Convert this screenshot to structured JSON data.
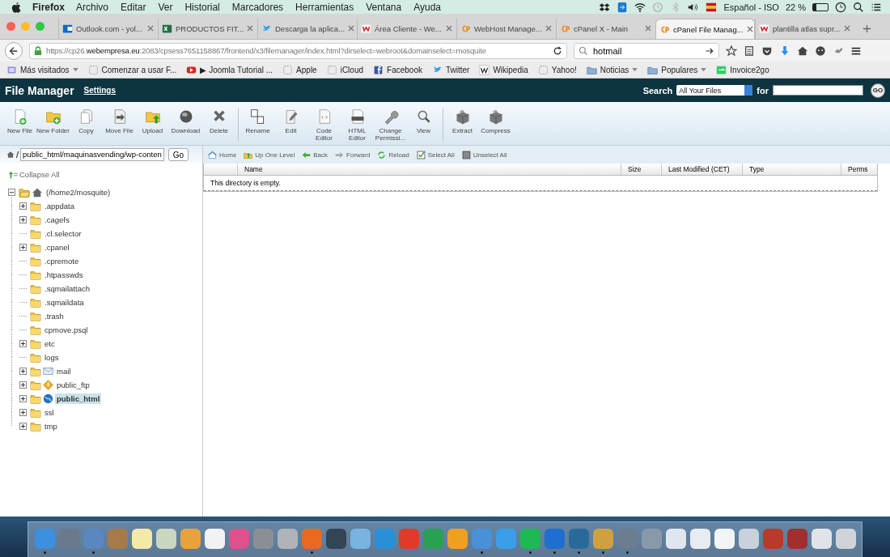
{
  "menubar": {
    "app": "Firefox",
    "menus": [
      "Archivo",
      "Editar",
      "Ver",
      "Historial",
      "Marcadores",
      "Herramientas",
      "Ventana",
      "Ayuda"
    ],
    "language": "Español - ISO",
    "battery": "22 %"
  },
  "tabs": [
    {
      "title": "Outlook.com - yol...",
      "selected": false
    },
    {
      "title": "PRODUCTOS FIT...",
      "selected": false
    },
    {
      "title": "Descarga la aplica...",
      "selected": false
    },
    {
      "title": "Área Cliente - We...",
      "selected": false
    },
    {
      "title": "WebHost Manage...",
      "selected": false
    },
    {
      "title": "cPanel X - Main",
      "selected": false
    },
    {
      "title": "cPanel File Manag...",
      "selected": true
    },
    {
      "title": "plantilla atlas supr...",
      "selected": false
    }
  ],
  "address": {
    "url_pre": "https://cp26.",
    "url_host": "webempresa.eu",
    "url_post": ":2083/cpsess7651158867/frontend/x3/filemanager/index.html?dirselect=webroot&domainselect=mosquite"
  },
  "search": {
    "value": "hotmail"
  },
  "bookmarks": [
    {
      "label": "Más visitados",
      "dropdown": true
    },
    {
      "label": "Comenzar a usar F...",
      "dropdown": false
    },
    {
      "label": "▶ Joomla Tutorial ...",
      "dropdown": false
    },
    {
      "label": "Apple",
      "dropdown": false
    },
    {
      "label": "iCloud",
      "dropdown": false
    },
    {
      "label": "Facebook",
      "dropdown": false
    },
    {
      "label": "Twitter",
      "dropdown": false
    },
    {
      "label": "Wikipedia",
      "dropdown": false
    },
    {
      "label": "Yahoo!",
      "dropdown": false
    },
    {
      "label": "Noticias",
      "dropdown": true
    },
    {
      "label": "Populares",
      "dropdown": true
    },
    {
      "label": "Invoice2go",
      "dropdown": false
    }
  ],
  "header": {
    "title": "File Manager",
    "settings": "Settings",
    "search_label": "Search",
    "search_scope": "All Your Files",
    "for_label": "for",
    "go": "GO"
  },
  "toolbar": [
    [
      "New File",
      "New Folder",
      "Copy",
      "Move File",
      "Upload",
      "Download",
      "Delete"
    ],
    [
      "Rename",
      "Edit",
      "Code Editor",
      "HTML Editor",
      "Change Permissi...",
      "View"
    ],
    [
      "Extract",
      "Compress"
    ]
  ],
  "path": {
    "separator": "/",
    "value": "public_html/maquinasvending/wp-conten",
    "go": "Go"
  },
  "nav": [
    "Home",
    "Up One Level",
    "Back",
    "Forward",
    "Reload",
    "Select All",
    "Unselect All"
  ],
  "tree": {
    "collapse_all": "Collapse All",
    "root": {
      "label": "(/home2/mosquite)",
      "expanded": true,
      "children": [
        {
          "label": ".appdata",
          "kind": "folder",
          "expandable": true,
          "selected": false
        },
        {
          "label": ".cagefs",
          "kind": "folder",
          "expandable": true,
          "selected": false
        },
        {
          "label": ".cl.selector",
          "kind": "folder",
          "expandable": false,
          "selected": false
        },
        {
          "label": ".cpanel",
          "kind": "folder",
          "expandable": true,
          "selected": false
        },
        {
          "label": ".cpremote",
          "kind": "folder",
          "expandable": false,
          "selected": false
        },
        {
          "label": ".htpasswds",
          "kind": "folder",
          "expandable": false,
          "selected": false
        },
        {
          "label": ".sqmailattach",
          "kind": "folder",
          "expandable": false,
          "selected": false
        },
        {
          "label": ".sqmaildata",
          "kind": "folder",
          "expandable": false,
          "selected": false
        },
        {
          "label": ".trash",
          "kind": "folder",
          "expandable": false,
          "selected": false
        },
        {
          "label": "cpmove.psql",
          "kind": "folder",
          "expandable": false,
          "selected": false
        },
        {
          "label": "etc",
          "kind": "folder",
          "expandable": true,
          "selected": false
        },
        {
          "label": "logs",
          "kind": "folder",
          "expandable": false,
          "selected": false
        },
        {
          "label": "mail",
          "kind": "mail",
          "expandable": true,
          "selected": false
        },
        {
          "label": "public_ftp",
          "kind": "ftp",
          "expandable": true,
          "selected": false
        },
        {
          "label": "public_html",
          "kind": "web",
          "expandable": true,
          "selected": true
        },
        {
          "label": "ssl",
          "kind": "folder",
          "expandable": true,
          "selected": false
        },
        {
          "label": "tmp",
          "kind": "folder",
          "expandable": true,
          "selected": false
        }
      ]
    }
  },
  "table": {
    "columns": [
      "Name",
      "Size",
      "Last Modified (CET)",
      "Type",
      "Perms"
    ],
    "empty_message": "This directory is empty."
  },
  "dock": [
    {
      "color": "#3d8fe0",
      "running": true
    },
    {
      "color": "#6a7a8c",
      "running": false
    },
    {
      "color": "#5b87c0",
      "running": true
    },
    {
      "color": "#a67a4b",
      "running": false
    },
    {
      "color": "#f5e9a8",
      "running": false
    },
    {
      "color": "#c9d6c0",
      "running": false
    },
    {
      "color": "#e8a23c",
      "running": false
    },
    {
      "color": "#f2f2f2",
      "running": false
    },
    {
      "color": "#e0508a",
      "running": false
    },
    {
      "color": "#8a8f96",
      "running": false
    },
    {
      "color": "#b0b4b8",
      "running": false
    },
    {
      "color": "#e86a1e",
      "running": true
    },
    {
      "color": "#334455",
      "running": false
    },
    {
      "color": "#7ab2e0",
      "running": false
    },
    {
      "color": "#2b8fd8",
      "running": false
    },
    {
      "color": "#e03a2a",
      "running": false
    },
    {
      "color": "#2aa052",
      "running": false
    },
    {
      "color": "#f0a020",
      "running": false
    },
    {
      "color": "#4a90d9",
      "running": true
    },
    {
      "color": "#3a9ee8",
      "running": false
    },
    {
      "color": "#1db954",
      "running": true
    },
    {
      "color": "#1e6fd0",
      "running": true
    },
    {
      "color": "#2a6a9a",
      "running": true
    },
    {
      "color": "#d0a040",
      "running": true
    },
    {
      "color": "#6b7d8f",
      "running": true
    },
    {
      "color": "#8899aa",
      "running": false
    },
    {
      "color": "#dfe6ee",
      "running": false
    },
    {
      "color": "#e6ecf2",
      "running": false
    },
    {
      "color": "#f2f4f6",
      "running": false
    },
    {
      "color": "#c8d2dc",
      "running": false
    },
    {
      "color": "#b83a2a",
      "running": false
    },
    {
      "color": "#a03030",
      "running": false
    },
    {
      "color": "#e0e4e8",
      "running": false
    },
    {
      "color": "#d0d4d8",
      "running": false
    }
  ]
}
